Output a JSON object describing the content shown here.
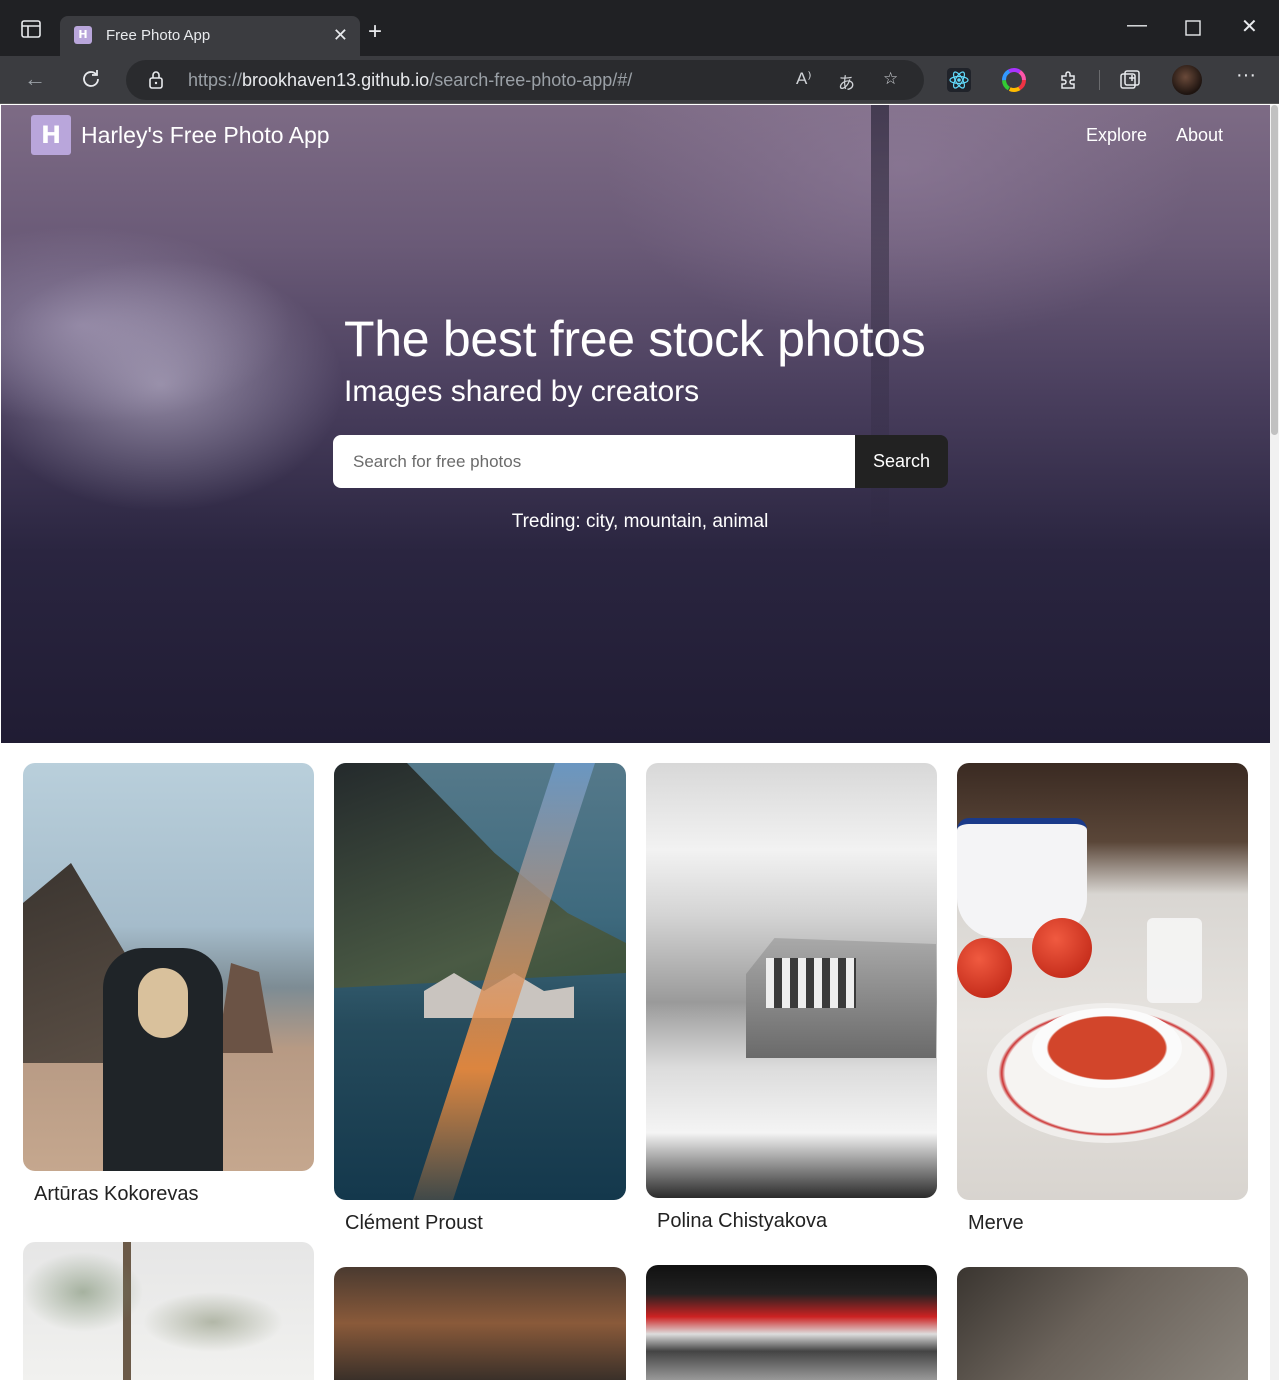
{
  "browser": {
    "tab_title": "Free Photo App",
    "tab_favicon_letter": "H",
    "url_prefix": "https://",
    "url_domain": "brookhaven13.github.io",
    "url_path": "/search-free-photo-app/#/"
  },
  "site": {
    "logo_letter": "H",
    "brand_name": "Harley's Free Photo App",
    "nav": [
      "Explore",
      "About"
    ]
  },
  "hero": {
    "headline": "The best free stock photos",
    "subheadline": "Images shared by creators",
    "search_placeholder": "Search for free photos",
    "search_button": "Search",
    "trending": "Treding: city, mountain, animal"
  },
  "photos": [
    {
      "author": "Artūras Kokorevas"
    },
    {
      "author": "Clément Proust"
    },
    {
      "author": "Polina Chistyakova"
    },
    {
      "author": "Merve"
    }
  ],
  "colors": {
    "brand_accent": "#b9a6db",
    "search_button_bg": "#222222",
    "hero_dark": "#201c33"
  }
}
